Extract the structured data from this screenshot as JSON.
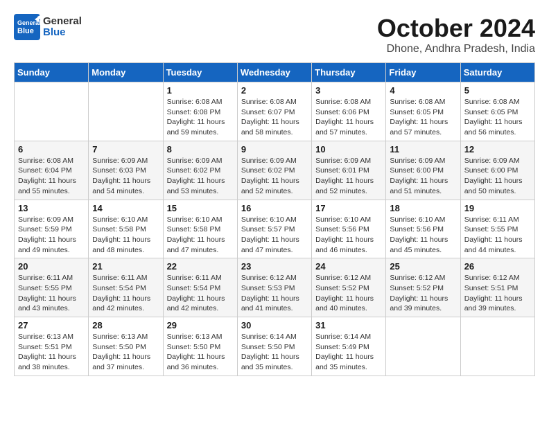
{
  "logo": {
    "line1": "General",
    "line2": "Blue"
  },
  "title": "October 2024",
  "location": "Dhone, Andhra Pradesh, India",
  "headers": [
    "Sunday",
    "Monday",
    "Tuesday",
    "Wednesday",
    "Thursday",
    "Friday",
    "Saturday"
  ],
  "weeks": [
    [
      {
        "day": "",
        "info": ""
      },
      {
        "day": "",
        "info": ""
      },
      {
        "day": "1",
        "info": "Sunrise: 6:08 AM\nSunset: 6:08 PM\nDaylight: 11 hours and 59 minutes."
      },
      {
        "day": "2",
        "info": "Sunrise: 6:08 AM\nSunset: 6:07 PM\nDaylight: 11 hours and 58 minutes."
      },
      {
        "day": "3",
        "info": "Sunrise: 6:08 AM\nSunset: 6:06 PM\nDaylight: 11 hours and 57 minutes."
      },
      {
        "day": "4",
        "info": "Sunrise: 6:08 AM\nSunset: 6:05 PM\nDaylight: 11 hours and 57 minutes."
      },
      {
        "day": "5",
        "info": "Sunrise: 6:08 AM\nSunset: 6:05 PM\nDaylight: 11 hours and 56 minutes."
      }
    ],
    [
      {
        "day": "6",
        "info": "Sunrise: 6:08 AM\nSunset: 6:04 PM\nDaylight: 11 hours and 55 minutes."
      },
      {
        "day": "7",
        "info": "Sunrise: 6:09 AM\nSunset: 6:03 PM\nDaylight: 11 hours and 54 minutes."
      },
      {
        "day": "8",
        "info": "Sunrise: 6:09 AM\nSunset: 6:02 PM\nDaylight: 11 hours and 53 minutes."
      },
      {
        "day": "9",
        "info": "Sunrise: 6:09 AM\nSunset: 6:02 PM\nDaylight: 11 hours and 52 minutes."
      },
      {
        "day": "10",
        "info": "Sunrise: 6:09 AM\nSunset: 6:01 PM\nDaylight: 11 hours and 52 minutes."
      },
      {
        "day": "11",
        "info": "Sunrise: 6:09 AM\nSunset: 6:00 PM\nDaylight: 11 hours and 51 minutes."
      },
      {
        "day": "12",
        "info": "Sunrise: 6:09 AM\nSunset: 6:00 PM\nDaylight: 11 hours and 50 minutes."
      }
    ],
    [
      {
        "day": "13",
        "info": "Sunrise: 6:09 AM\nSunset: 5:59 PM\nDaylight: 11 hours and 49 minutes."
      },
      {
        "day": "14",
        "info": "Sunrise: 6:10 AM\nSunset: 5:58 PM\nDaylight: 11 hours and 48 minutes."
      },
      {
        "day": "15",
        "info": "Sunrise: 6:10 AM\nSunset: 5:58 PM\nDaylight: 11 hours and 47 minutes."
      },
      {
        "day": "16",
        "info": "Sunrise: 6:10 AM\nSunset: 5:57 PM\nDaylight: 11 hours and 47 minutes."
      },
      {
        "day": "17",
        "info": "Sunrise: 6:10 AM\nSunset: 5:56 PM\nDaylight: 11 hours and 46 minutes."
      },
      {
        "day": "18",
        "info": "Sunrise: 6:10 AM\nSunset: 5:56 PM\nDaylight: 11 hours and 45 minutes."
      },
      {
        "day": "19",
        "info": "Sunrise: 6:11 AM\nSunset: 5:55 PM\nDaylight: 11 hours and 44 minutes."
      }
    ],
    [
      {
        "day": "20",
        "info": "Sunrise: 6:11 AM\nSunset: 5:55 PM\nDaylight: 11 hours and 43 minutes."
      },
      {
        "day": "21",
        "info": "Sunrise: 6:11 AM\nSunset: 5:54 PM\nDaylight: 11 hours and 42 minutes."
      },
      {
        "day": "22",
        "info": "Sunrise: 6:11 AM\nSunset: 5:54 PM\nDaylight: 11 hours and 42 minutes."
      },
      {
        "day": "23",
        "info": "Sunrise: 6:12 AM\nSunset: 5:53 PM\nDaylight: 11 hours and 41 minutes."
      },
      {
        "day": "24",
        "info": "Sunrise: 6:12 AM\nSunset: 5:52 PM\nDaylight: 11 hours and 40 minutes."
      },
      {
        "day": "25",
        "info": "Sunrise: 6:12 AM\nSunset: 5:52 PM\nDaylight: 11 hours and 39 minutes."
      },
      {
        "day": "26",
        "info": "Sunrise: 6:12 AM\nSunset: 5:51 PM\nDaylight: 11 hours and 39 minutes."
      }
    ],
    [
      {
        "day": "27",
        "info": "Sunrise: 6:13 AM\nSunset: 5:51 PM\nDaylight: 11 hours and 38 minutes."
      },
      {
        "day": "28",
        "info": "Sunrise: 6:13 AM\nSunset: 5:50 PM\nDaylight: 11 hours and 37 minutes."
      },
      {
        "day": "29",
        "info": "Sunrise: 6:13 AM\nSunset: 5:50 PM\nDaylight: 11 hours and 36 minutes."
      },
      {
        "day": "30",
        "info": "Sunrise: 6:14 AM\nSunset: 5:50 PM\nDaylight: 11 hours and 35 minutes."
      },
      {
        "day": "31",
        "info": "Sunrise: 6:14 AM\nSunset: 5:49 PM\nDaylight: 11 hours and 35 minutes."
      },
      {
        "day": "",
        "info": ""
      },
      {
        "day": "",
        "info": ""
      }
    ]
  ]
}
